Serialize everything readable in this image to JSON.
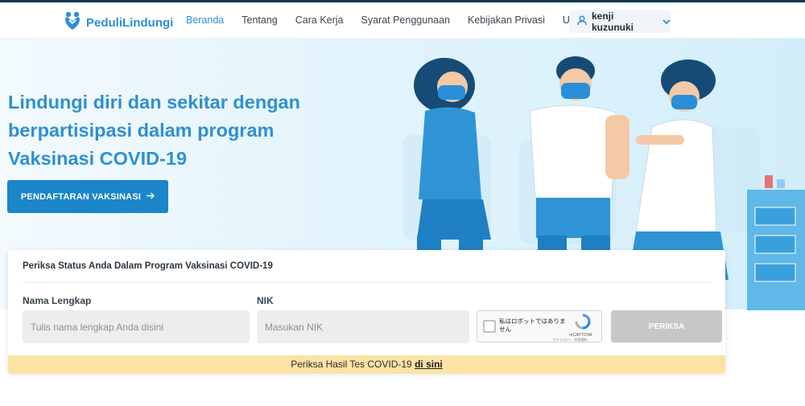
{
  "nav": {
    "logo_text": "PeduliLindungi",
    "links": [
      {
        "label": "Beranda",
        "active": true
      },
      {
        "label": "Tentang"
      },
      {
        "label": "Cara Kerja"
      },
      {
        "label": "Syarat Penggunaan"
      },
      {
        "label": "Kebijakan Privasi"
      },
      {
        "label": "Unduh"
      }
    ],
    "user_name": "kenji kuzunuki"
  },
  "hero": {
    "title": "Lindungi diri dan sekitar dengan berpartisipasi dalam program Vaksinasi COVID-19",
    "cta_label": "PENDAFTARAN VAKSINASI"
  },
  "form": {
    "title": "Periksa Status Anda Dalam Program Vaksinasi COVID-19",
    "name_label": "Nama Lengkap",
    "name_placeholder": "Tulis nama lengkap Anda disini",
    "nik_label": "NIK",
    "nik_placeholder": "Masukan NIK",
    "captcha_text": "私はロボットではありません",
    "captcha_brand": "reCAPTCHA",
    "captcha_terms": "プライバシー - 利用規約",
    "submit_label": "PERIKSA"
  },
  "banner": {
    "text": "Periksa Hasil Tes COVID-19",
    "link": "di sini"
  },
  "colors": {
    "brand": "#2c8fd6",
    "cta": "#1b85c7",
    "banner": "#fbe3a6"
  }
}
